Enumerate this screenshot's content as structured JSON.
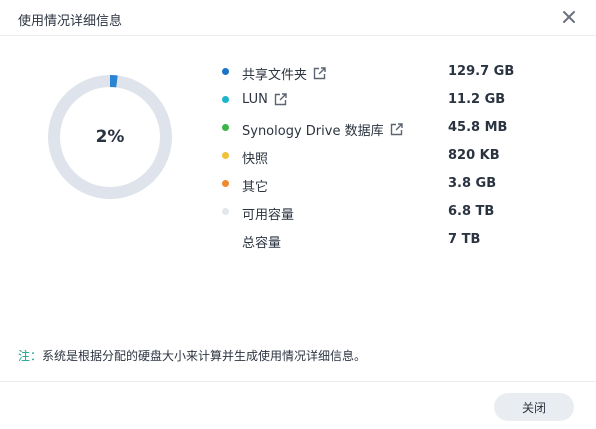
{
  "dialog": {
    "title": "使用情况详细信息",
    "close_icon": "close-icon"
  },
  "usage": {
    "percent_label": "2%",
    "used_fraction": 0.02,
    "ring_color": "#2b84d2",
    "track_color": "#dfe4ec"
  },
  "items": [
    {
      "name": "共享文件夹",
      "value": "129.7 GB",
      "color": "#1a73c8",
      "has_link": true,
      "icon": "external-link-icon"
    },
    {
      "name": "LUN",
      "value": "11.2 GB",
      "color": "#1cb4c9",
      "has_link": true,
      "icon": "external-link-icon"
    },
    {
      "name": "Synology Drive 数据库",
      "value": "45.8 MB",
      "color": "#3ab54a",
      "has_link": true,
      "icon": "external-link-icon"
    },
    {
      "name": "快照",
      "value": "820 KB",
      "color": "#f2c13a",
      "has_link": false
    },
    {
      "name": "其它",
      "value": "3.8 GB",
      "color": "#f0892d",
      "has_link": false
    },
    {
      "name": "可用容量",
      "value": "6.8 TB",
      "color": "#e3e6eb",
      "has_link": false
    },
    {
      "name": "总容量",
      "value": "7 TB",
      "color": "",
      "has_link": false
    }
  ],
  "note": {
    "prefix": "注：",
    "text": "系统是根据分配的硬盘大小来计算并生成使用情况详细信息。"
  },
  "footer": {
    "close_label": "关闭"
  }
}
